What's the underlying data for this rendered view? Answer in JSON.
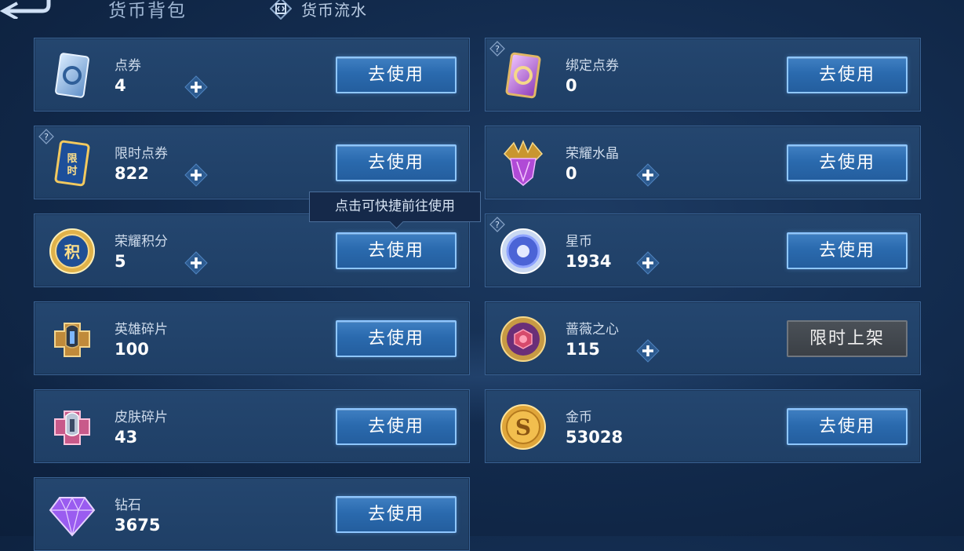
{
  "header": {
    "title": "货币背包",
    "ledger_tab": "货币流水"
  },
  "tooltip": "点击可快捷前往使用",
  "use_label": "去使用",
  "items": [
    {
      "name": "点券",
      "amount": "4",
      "icon": "ticket-icon"
    },
    {
      "name": "绑定点券",
      "amount": "0",
      "icon": "bound-ticket-icon"
    },
    {
      "name": "限时点券",
      "amount": "822",
      "icon": "limited-ticket-icon"
    },
    {
      "name": "荣耀水晶",
      "amount": "0",
      "icon": "glory-crystal-icon"
    },
    {
      "name": "荣耀积分",
      "amount": "5",
      "icon": "glory-points-icon"
    },
    {
      "name": "星币",
      "amount": "1934",
      "icon": "star-coin-icon"
    },
    {
      "name": "英雄碎片",
      "amount": "100",
      "icon": "hero-shard-icon"
    },
    {
      "name": "蔷薇之心",
      "amount": "115",
      "icon": "rose-heart-icon",
      "button": "限时上架"
    },
    {
      "name": "皮肤碎片",
      "amount": "43",
      "icon": "skin-shard-icon"
    },
    {
      "name": "金币",
      "amount": "53028",
      "icon": "gold-coin-icon"
    },
    {
      "name": "钻石",
      "amount": "3675",
      "icon": "diamond-icon"
    }
  ],
  "colors": {
    "accent": "#8ec6ff",
    "button": "#2a6aae",
    "card": "#22436b"
  }
}
